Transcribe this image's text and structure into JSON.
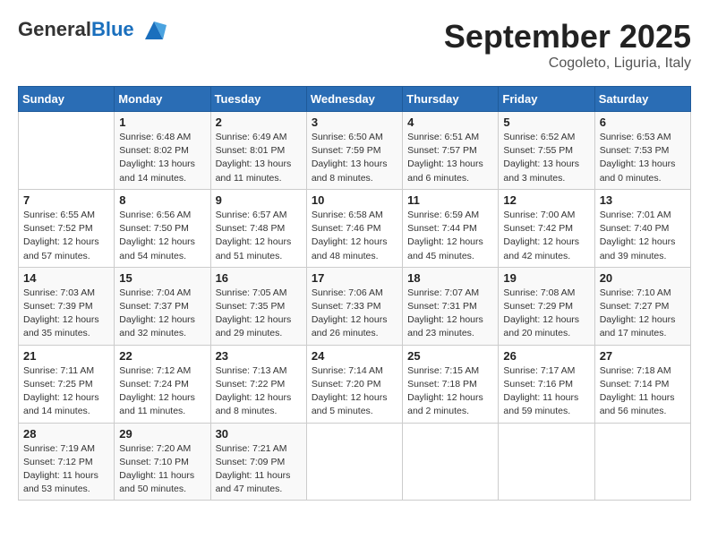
{
  "header": {
    "logo_general": "General",
    "logo_blue": "Blue",
    "month_title": "September 2025",
    "subtitle": "Cogoleto, Liguria, Italy"
  },
  "calendar": {
    "weekdays": [
      "Sunday",
      "Monday",
      "Tuesday",
      "Wednesday",
      "Thursday",
      "Friday",
      "Saturday"
    ],
    "weeks": [
      [
        {
          "day": "",
          "info": ""
        },
        {
          "day": "1",
          "info": "Sunrise: 6:48 AM\nSunset: 8:02 PM\nDaylight: 13 hours\nand 14 minutes."
        },
        {
          "day": "2",
          "info": "Sunrise: 6:49 AM\nSunset: 8:01 PM\nDaylight: 13 hours\nand 11 minutes."
        },
        {
          "day": "3",
          "info": "Sunrise: 6:50 AM\nSunset: 7:59 PM\nDaylight: 13 hours\nand 8 minutes."
        },
        {
          "day": "4",
          "info": "Sunrise: 6:51 AM\nSunset: 7:57 PM\nDaylight: 13 hours\nand 6 minutes."
        },
        {
          "day": "5",
          "info": "Sunrise: 6:52 AM\nSunset: 7:55 PM\nDaylight: 13 hours\nand 3 minutes."
        },
        {
          "day": "6",
          "info": "Sunrise: 6:53 AM\nSunset: 7:53 PM\nDaylight: 13 hours\nand 0 minutes."
        }
      ],
      [
        {
          "day": "7",
          "info": "Sunrise: 6:55 AM\nSunset: 7:52 PM\nDaylight: 12 hours\nand 57 minutes."
        },
        {
          "day": "8",
          "info": "Sunrise: 6:56 AM\nSunset: 7:50 PM\nDaylight: 12 hours\nand 54 minutes."
        },
        {
          "day": "9",
          "info": "Sunrise: 6:57 AM\nSunset: 7:48 PM\nDaylight: 12 hours\nand 51 minutes."
        },
        {
          "day": "10",
          "info": "Sunrise: 6:58 AM\nSunset: 7:46 PM\nDaylight: 12 hours\nand 48 minutes."
        },
        {
          "day": "11",
          "info": "Sunrise: 6:59 AM\nSunset: 7:44 PM\nDaylight: 12 hours\nand 45 minutes."
        },
        {
          "day": "12",
          "info": "Sunrise: 7:00 AM\nSunset: 7:42 PM\nDaylight: 12 hours\nand 42 minutes."
        },
        {
          "day": "13",
          "info": "Sunrise: 7:01 AM\nSunset: 7:40 PM\nDaylight: 12 hours\nand 39 minutes."
        }
      ],
      [
        {
          "day": "14",
          "info": "Sunrise: 7:03 AM\nSunset: 7:39 PM\nDaylight: 12 hours\nand 35 minutes."
        },
        {
          "day": "15",
          "info": "Sunrise: 7:04 AM\nSunset: 7:37 PM\nDaylight: 12 hours\nand 32 minutes."
        },
        {
          "day": "16",
          "info": "Sunrise: 7:05 AM\nSunset: 7:35 PM\nDaylight: 12 hours\nand 29 minutes."
        },
        {
          "day": "17",
          "info": "Sunrise: 7:06 AM\nSunset: 7:33 PM\nDaylight: 12 hours\nand 26 minutes."
        },
        {
          "day": "18",
          "info": "Sunrise: 7:07 AM\nSunset: 7:31 PM\nDaylight: 12 hours\nand 23 minutes."
        },
        {
          "day": "19",
          "info": "Sunrise: 7:08 AM\nSunset: 7:29 PM\nDaylight: 12 hours\nand 20 minutes."
        },
        {
          "day": "20",
          "info": "Sunrise: 7:10 AM\nSunset: 7:27 PM\nDaylight: 12 hours\nand 17 minutes."
        }
      ],
      [
        {
          "day": "21",
          "info": "Sunrise: 7:11 AM\nSunset: 7:25 PM\nDaylight: 12 hours\nand 14 minutes."
        },
        {
          "day": "22",
          "info": "Sunrise: 7:12 AM\nSunset: 7:24 PM\nDaylight: 12 hours\nand 11 minutes."
        },
        {
          "day": "23",
          "info": "Sunrise: 7:13 AM\nSunset: 7:22 PM\nDaylight: 12 hours\nand 8 minutes."
        },
        {
          "day": "24",
          "info": "Sunrise: 7:14 AM\nSunset: 7:20 PM\nDaylight: 12 hours\nand 5 minutes."
        },
        {
          "day": "25",
          "info": "Sunrise: 7:15 AM\nSunset: 7:18 PM\nDaylight: 12 hours\nand 2 minutes."
        },
        {
          "day": "26",
          "info": "Sunrise: 7:17 AM\nSunset: 7:16 PM\nDaylight: 11 hours\nand 59 minutes."
        },
        {
          "day": "27",
          "info": "Sunrise: 7:18 AM\nSunset: 7:14 PM\nDaylight: 11 hours\nand 56 minutes."
        }
      ],
      [
        {
          "day": "28",
          "info": "Sunrise: 7:19 AM\nSunset: 7:12 PM\nDaylight: 11 hours\nand 53 minutes."
        },
        {
          "day": "29",
          "info": "Sunrise: 7:20 AM\nSunset: 7:10 PM\nDaylight: 11 hours\nand 50 minutes."
        },
        {
          "day": "30",
          "info": "Sunrise: 7:21 AM\nSunset: 7:09 PM\nDaylight: 11 hours\nand 47 minutes."
        },
        {
          "day": "",
          "info": ""
        },
        {
          "day": "",
          "info": ""
        },
        {
          "day": "",
          "info": ""
        },
        {
          "day": "",
          "info": ""
        }
      ]
    ]
  }
}
